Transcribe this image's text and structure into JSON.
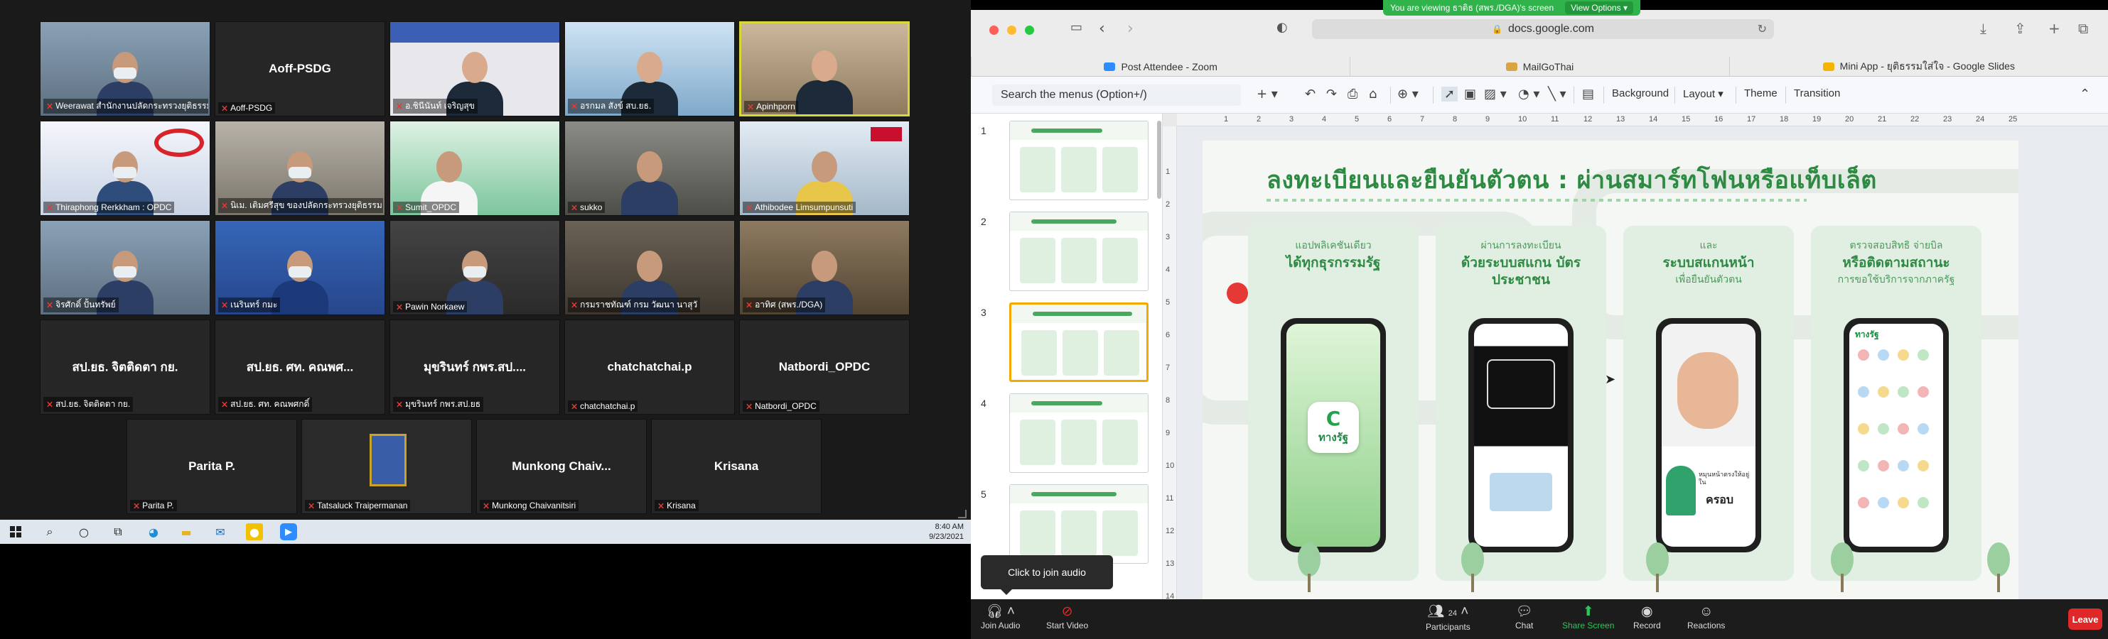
{
  "zoom_gallery": {
    "rows": [
      [
        {
          "name": "Weerawat สำนักงานปลัดกระทรวงยุติธรรม",
          "big": "",
          "video": "masked"
        },
        {
          "name": "Aoff-PSDG",
          "big": "Aoff-PSDG",
          "video": "none"
        },
        {
          "name": "อ.ชินีนันท์ เจริญสุข",
          "big": "",
          "video": "woman-banner"
        },
        {
          "name": "อรกมล สังข์ สบ.ยธ.",
          "big": "",
          "video": "woman-office"
        },
        {
          "name": "Apinhporn",
          "big": "",
          "video": "woman-room",
          "active": true
        }
      ],
      [
        {
          "name": "Thiraphong Rerkkham : OPDC",
          "big": "",
          "video": "nws"
        },
        {
          "name": "นิเม. เติมศรีสุข ของปลัดกระทรวงยุติธรรม",
          "big": "",
          "video": "masked-man"
        },
        {
          "name": "Sumit_OPDC",
          "big": "",
          "video": "poster"
        },
        {
          "name": "sukko",
          "big": "",
          "video": "man-dark"
        },
        {
          "name": "Athibodee Limsumpunsuti",
          "big": "",
          "video": "dga"
        }
      ],
      [
        {
          "name": "จิรศักดิ์ ปั้นทรัพย์",
          "big": "",
          "video": "masked"
        },
        {
          "name": "เนรินทร์ กมะ",
          "big": "",
          "video": "masked-blue"
        },
        {
          "name": "Pawin Norkaew",
          "big": "",
          "video": "masked-red"
        },
        {
          "name": "กรมราชทัณฑ์ กรม วัฒนา นาสุวั",
          "big": "",
          "video": "man-suit"
        },
        {
          "name": "อาทิศ (สพร./DGA)",
          "big": "",
          "video": "man-glasses"
        }
      ],
      [
        {
          "name": "สป.ยธ. จิตติดตา กย.",
          "big": "สป.ยธ. จิตติดตา กย.",
          "video": "none"
        },
        {
          "name": "สป.ยธ. ศท. คณพศกดิ์",
          "big": "สป.ยธ. ศท. คณพศ...",
          "video": "none"
        },
        {
          "name": "มุขรินทร์ กพร.สป.ยธ",
          "big": "มุขรินทร์ กพร.สป....",
          "video": "none"
        },
        {
          "name": "chatchatchai.p",
          "big": "chatchatchai.p",
          "video": "none"
        },
        {
          "name": "Natbordi_OPDC",
          "big": "Natbordi_OPDC",
          "video": "none"
        }
      ],
      [
        {
          "name": "Parita P.",
          "big": "Parita P.",
          "video": "none"
        },
        {
          "name": "Tatsaluck Traipermanan",
          "big": "",
          "video": "emblem"
        },
        {
          "name": "Munkong Chaivanitsiri",
          "big": "Munkong  Chaiv...",
          "video": "none"
        },
        {
          "name": "Krisana",
          "big": "Krisana",
          "video": "none"
        }
      ]
    ]
  },
  "taskbar": {
    "time": "8:40 AM",
    "date": "9/23/2021"
  },
  "share": {
    "viewing_text": "You are viewing ธาติธ (สพร./DGA)'s screen",
    "view_options": "View Options"
  },
  "browser": {
    "url": "docs.google.com",
    "tabs": [
      {
        "label": "Post Attendee - Zoom",
        "color": "#2d8cff"
      },
      {
        "label": "MailGoThai",
        "color": "#d9a441"
      },
      {
        "label": "Mini App - ยุติธรรมใส่ใจ - Google Slides",
        "color": "#f4b400"
      }
    ]
  },
  "slides_toolbar": {
    "search": "Search the menus (Option+/)",
    "background": "Background",
    "layout": "Layout",
    "theme": "Theme",
    "transition": "Transition"
  },
  "filmstrip": [
    {
      "num": "1",
      "selected": false
    },
    {
      "num": "2",
      "selected": false
    },
    {
      "num": "3",
      "selected": true
    },
    {
      "num": "4",
      "selected": false
    },
    {
      "num": "5",
      "selected": false
    }
  ],
  "ruler": {
    "top": [
      "1",
      "2",
      "3",
      "4",
      "5",
      "6",
      "7",
      "8",
      "9",
      "10",
      "11",
      "12",
      "13",
      "14",
      "15",
      "16",
      "17",
      "18",
      "19",
      "20",
      "21",
      "22",
      "23",
      "24",
      "25"
    ],
    "left": [
      "1",
      "2",
      "3",
      "4",
      "5",
      "6",
      "7",
      "8",
      "9",
      "10",
      "11",
      "12",
      "13",
      "14"
    ]
  },
  "slide": {
    "title": "ลงทะเบียนและยืนยันตัวตน : ผ่านสมาร์ทโฟนหรือแท็บเล็ต",
    "cards": [
      {
        "small": "แอปพลิเคชันเดียว",
        "large": "ได้ทุกธุรกรรมรัฐ",
        "screen": "app"
      },
      {
        "small": "ผ่านการลงทะเบียน",
        "large": "ด้วยระบบสแกน\nบัตรประชาชน",
        "screen": "idscan"
      },
      {
        "small": "และ",
        "large": "ระบบสแกนหน้า",
        "small2": "เพื่อยืนยันตัวตน",
        "screen": "face"
      },
      {
        "small": "ตรวจสอบสิทธิ จ่ายบิล",
        "large": "หรือติดตามสถานะ",
        "small2": "การขอใช้บริการจากภาครัฐ",
        "screen": "menu"
      }
    ],
    "app_name": "ทางรัฐ",
    "face_caption": "ครอบ",
    "face_caption_small": "หมุนหน้าตรงให้อยู่ใน"
  },
  "zoom_bar": {
    "join_audio": "Join Audio",
    "start_video": "Start Video",
    "participants": "Participants",
    "participants_count": "24",
    "chat": "Chat",
    "share_screen": "Share Screen",
    "record": "Record",
    "reactions": "Reactions",
    "leave": "Leave",
    "tooltip": "Click to join audio"
  },
  "colors": {
    "accent": "#2e8a43",
    "zoom_green": "#2fb34a",
    "leave_red": "#e02828",
    "highlight": "#d6d83a"
  }
}
